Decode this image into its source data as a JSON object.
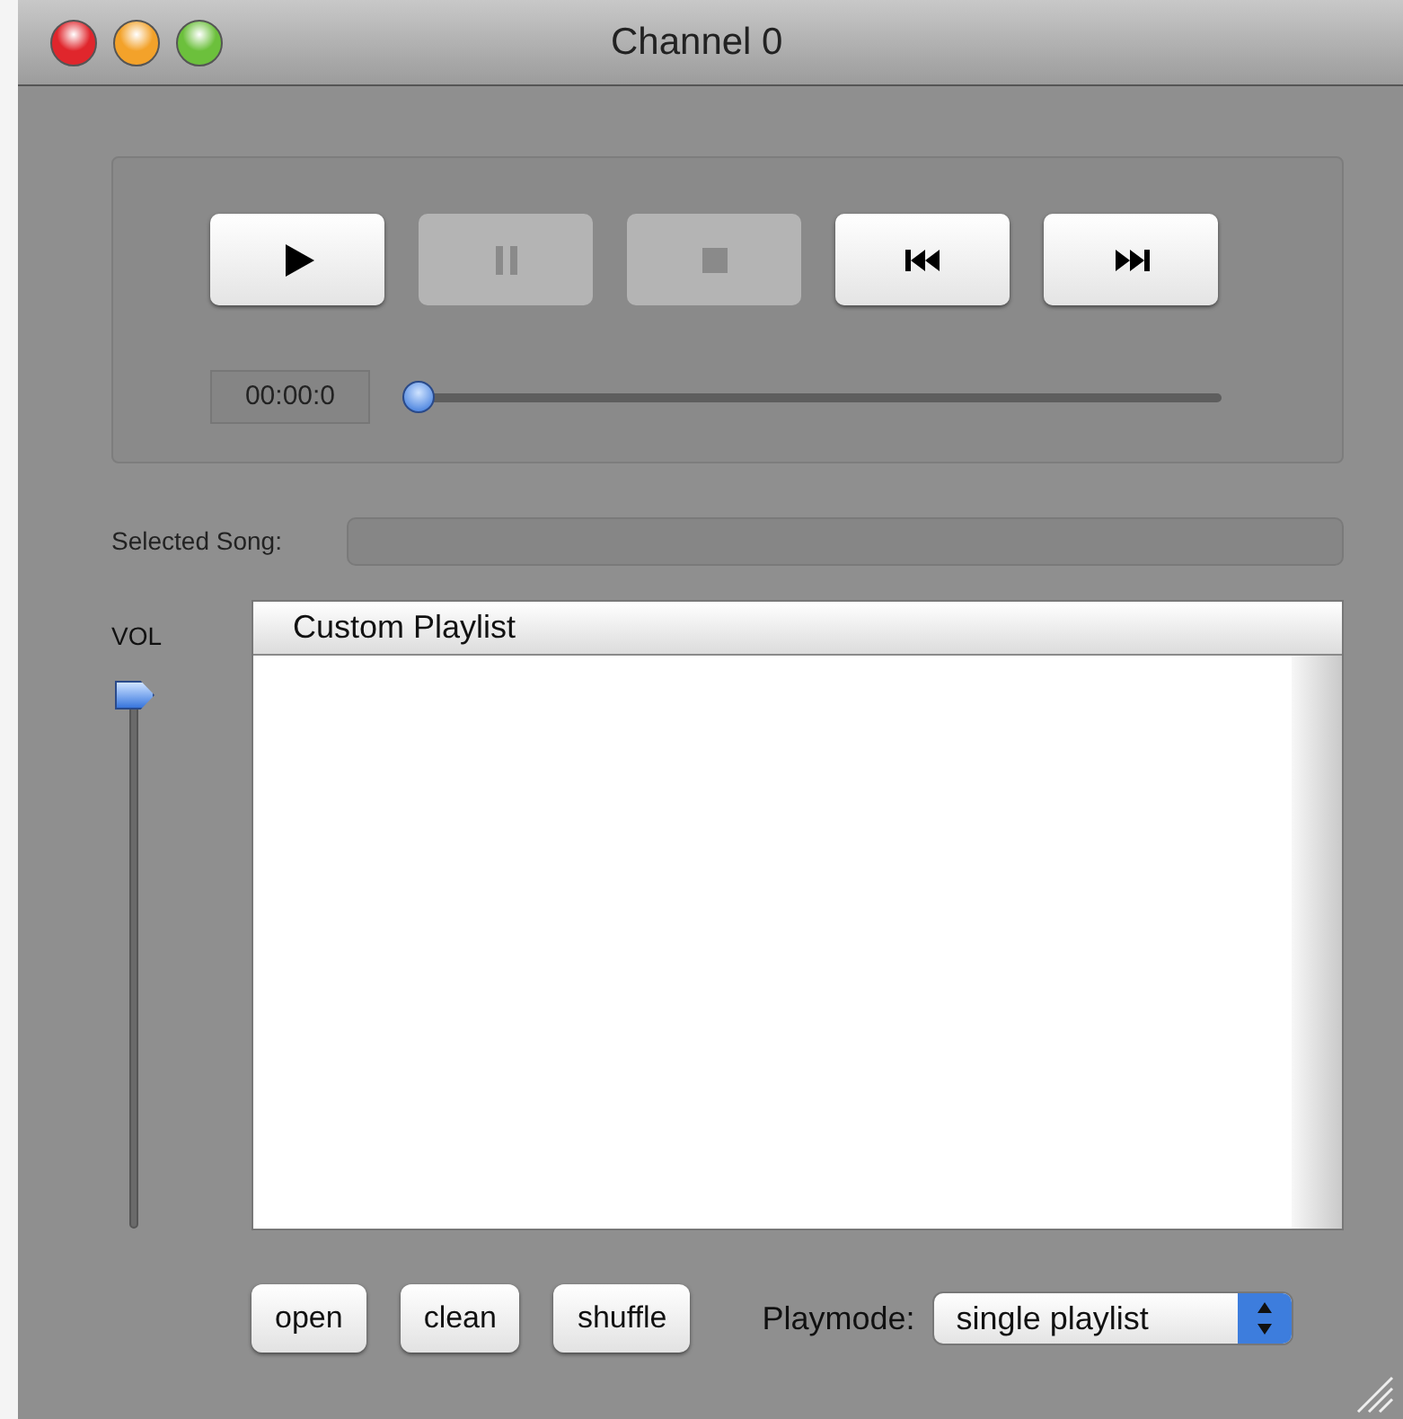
{
  "window": {
    "title": "Channel 0"
  },
  "transport": {
    "buttons": [
      {
        "kind": "play",
        "disabled": false
      },
      {
        "kind": "pause",
        "disabled": true
      },
      {
        "kind": "stop",
        "disabled": true
      },
      {
        "kind": "previous",
        "disabled": false
      },
      {
        "kind": "next",
        "disabled": false
      }
    ]
  },
  "position": {
    "time": "00:00:0",
    "level": 0
  },
  "selected_song": {
    "label": "Selected Song:"
  },
  "volume": {
    "label": "VOL",
    "level": 1
  },
  "playlist": {
    "header": "Custom Playlist"
  },
  "actions": [
    "open",
    "clean",
    "shuffle"
  ],
  "playmode": {
    "label": "Playmode:",
    "value": "single playlist"
  }
}
